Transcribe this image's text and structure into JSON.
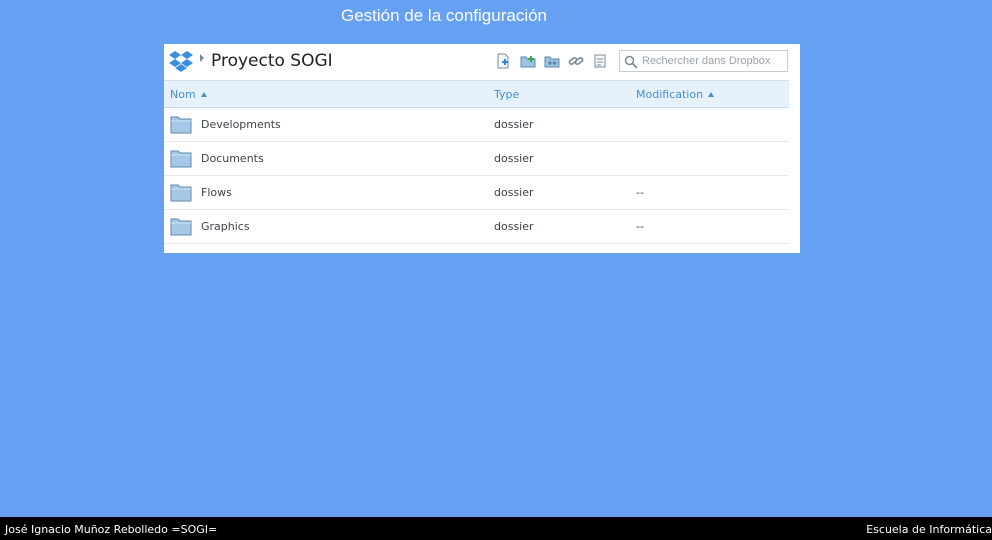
{
  "slide": {
    "title": "Gestión de la configuración"
  },
  "topbar": {
    "folder_name": "Proyecto SOGI",
    "icons": [
      "dropbox-logo-icon",
      "breadcrumb-arrow-icon",
      "new-file-icon",
      "new-folder-icon",
      "shared-folder-icon",
      "share-link-icon",
      "deleted-files-icon"
    ]
  },
  "search": {
    "placeholder": "Rechercher dans Dropbox"
  },
  "table": {
    "columns": [
      "Nom",
      "Type",
      "Modification"
    ],
    "rows": [
      {
        "name": "Developments",
        "type": "dossier",
        "modified": ""
      },
      {
        "name": "Documents",
        "type": "dossier",
        "modified": ""
      },
      {
        "name": "Flows",
        "type": "dossier",
        "modified": "--"
      },
      {
        "name": "Graphics",
        "type": "dossier",
        "modified": "--"
      }
    ]
  },
  "footer": {
    "left": "José Ignacio Muñoz Rebolledo =SOGI=",
    "right": "Escuela de Informática"
  },
  "colors": {
    "slide_background": "#66a0f2",
    "header_row": "#e5f1fb",
    "header_text": "#4691c8",
    "footer": "#000000"
  }
}
